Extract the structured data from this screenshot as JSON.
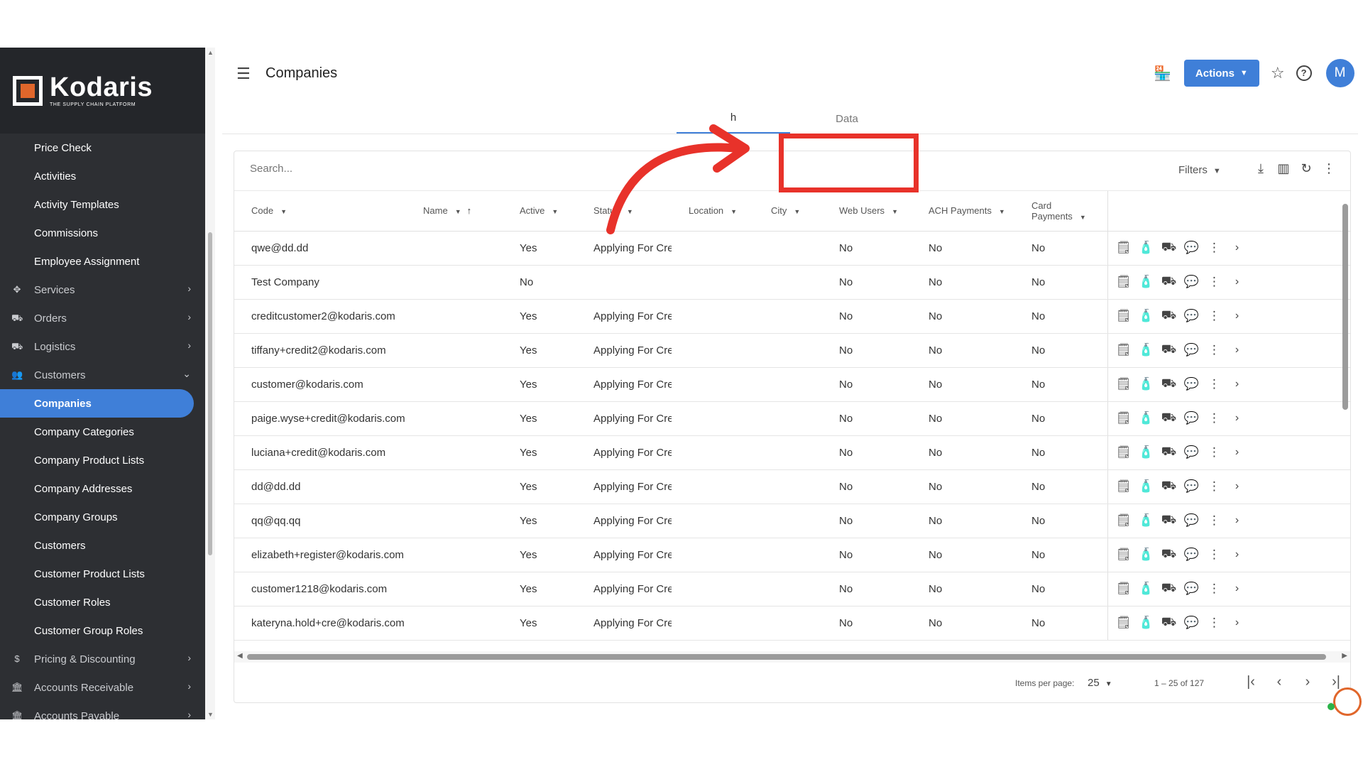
{
  "brand": {
    "name": "Kodaris",
    "tagline": "THE SUPPLY CHAIN PLATFORM"
  },
  "sidebar": {
    "items": [
      {
        "label": "Price Check",
        "type": "link"
      },
      {
        "label": "Activities",
        "type": "link"
      },
      {
        "label": "Activity Templates",
        "type": "link"
      },
      {
        "label": "Commissions",
        "type": "link"
      },
      {
        "label": "Employee Assignment",
        "type": "link"
      },
      {
        "label": "Services",
        "type": "section",
        "icon": "services-icon"
      },
      {
        "label": "Orders",
        "type": "section",
        "icon": "truck-icon"
      },
      {
        "label": "Logistics",
        "type": "section",
        "icon": "logistics-icon"
      },
      {
        "label": "Customers",
        "type": "section",
        "icon": "people-icon"
      },
      {
        "label": "Companies",
        "type": "link",
        "active": true
      },
      {
        "label": "Company Categories",
        "type": "link"
      },
      {
        "label": "Company Product Lists",
        "type": "link"
      },
      {
        "label": "Company Addresses",
        "type": "link"
      },
      {
        "label": "Company Groups",
        "type": "link"
      },
      {
        "label": "Customers",
        "type": "link"
      },
      {
        "label": "Customer Product Lists",
        "type": "link"
      },
      {
        "label": "Customer Roles",
        "type": "link"
      },
      {
        "label": "Customer Group Roles",
        "type": "link"
      },
      {
        "label": "Pricing & Discounting",
        "type": "section",
        "icon": "dollar-icon"
      },
      {
        "label": "Accounts Receivable",
        "type": "section",
        "icon": "bank-icon"
      },
      {
        "label": "Accounts Payable",
        "type": "section",
        "icon": "bank-icon"
      }
    ]
  },
  "header": {
    "title": "Companies",
    "actions_label": "Actions",
    "avatar_initial": "M"
  },
  "tabs": [
    {
      "label": "h",
      "active": true
    },
    {
      "label": "Data",
      "active": false
    }
  ],
  "search": {
    "placeholder": "Search..."
  },
  "toolbar": {
    "filters_label": "Filters"
  },
  "table": {
    "columns": [
      "Code",
      "Name",
      "Active",
      "Status",
      "Location",
      "City",
      "Web Users",
      "ACH Payments",
      "Card Payments"
    ],
    "rows": [
      [
        "qwe@dd.dd",
        "",
        "Yes",
        "Applying For Credit",
        "",
        "",
        "No",
        "No",
        "No"
      ],
      [
        "Test Company",
        "",
        "No",
        "",
        "",
        "",
        "No",
        "No",
        "No"
      ],
      [
        "creditcustomer2@kodaris.com",
        "",
        "Yes",
        "Applying For Credit",
        "",
        "",
        "No",
        "No",
        "No"
      ],
      [
        "tiffany+credit2@kodaris.com",
        "",
        "Yes",
        "Applying For Credit",
        "",
        "",
        "No",
        "No",
        "No"
      ],
      [
        "customer@kodaris.com",
        "",
        "Yes",
        "Applying For Credit",
        "",
        "",
        "No",
        "No",
        "No"
      ],
      [
        "paige.wyse+credit@kodaris.com",
        "",
        "Yes",
        "Applying For Credit",
        "",
        "",
        "No",
        "No",
        "No"
      ],
      [
        "luciana+credit@kodaris.com",
        "",
        "Yes",
        "Applying For Credit",
        "",
        "",
        "No",
        "No",
        "No"
      ],
      [
        "dd@dd.dd",
        "",
        "Yes",
        "Applying For Credit",
        "",
        "",
        "No",
        "No",
        "No"
      ],
      [
        "qq@qq.qq",
        "",
        "Yes",
        "Applying For Credit",
        "",
        "",
        "No",
        "No",
        "No"
      ],
      [
        "elizabeth+register@kodaris.com",
        "",
        "Yes",
        "Applying For Credit",
        "",
        "",
        "No",
        "No",
        "No"
      ],
      [
        "customer1218@kodaris.com",
        "",
        "Yes",
        "Applying For Credit",
        "",
        "",
        "No",
        "No",
        "No"
      ],
      [
        "kateryna.hold+cre@kodaris.com",
        "",
        "Yes",
        "Applying For Credit",
        "",
        "",
        "No",
        "No",
        "No"
      ]
    ]
  },
  "pagination": {
    "items_per_page_label": "Items per page:",
    "items_per_page": "25",
    "range": "1 – 25 of 127"
  },
  "colors": {
    "accent": "#3f7fd8",
    "sidebar": "#2d2f33",
    "annotation": "#e8322a",
    "brand_orange": "#e0662b"
  }
}
